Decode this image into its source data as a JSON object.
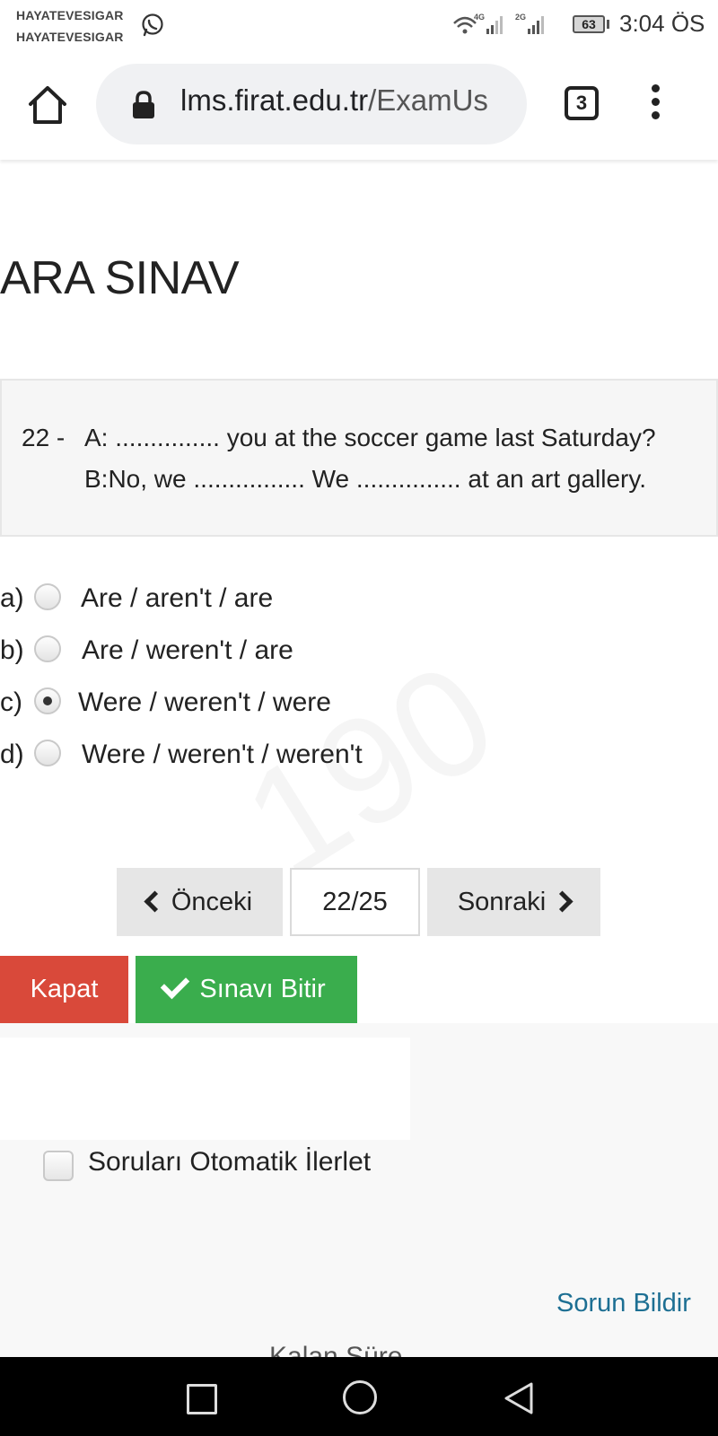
{
  "status_bar": {
    "notification_line1": "HAYATEVESIGAR",
    "notification_line2": "HAYATEVESIGAR",
    "notification_app_icon": "whatsapp-icon",
    "network_label_1": "4G",
    "network_label_2": "2G",
    "battery_level": "63",
    "time": "3:04 ÖS"
  },
  "browser": {
    "url_host": "lms.firat.edu.tr",
    "url_path": "/ExamUs",
    "tab_count": "3",
    "icons": [
      "home-icon",
      "lock-icon",
      "tabs-icon",
      "overflow-menu-icon"
    ]
  },
  "page": {
    "title": "ARA SINAV",
    "question": {
      "number": "22 -",
      "line1": "A: ............... you at the soccer game last Saturday?",
      "line2": "B:No, we ................ We ............... at an art gallery."
    },
    "options": [
      {
        "letter": "a)",
        "text": "Are / aren't / are",
        "selected": false
      },
      {
        "letter": "b)",
        "text": "Are / weren't / are",
        "selected": false
      },
      {
        "letter": "c)",
        "text": "Were / weren't / were",
        "selected": true
      },
      {
        "letter": "d)",
        "text": "Were / weren't / weren't",
        "selected": false
      }
    ],
    "watermark": "190",
    "navigation": {
      "previous_label": "Önceki",
      "counter": "22/25",
      "next_label": "Sonraki"
    },
    "close_label": "Kapat",
    "finish_label": "Sınavı Bitir",
    "auto_advance_label": "Soruları Otomatik İlerlet",
    "auto_advance_checked": false,
    "report_link": "Sorun Bildir",
    "cutoff_text": "Kalan Süre"
  },
  "colors": {
    "close_button": "#d9493a",
    "finish_button": "#3aad4d",
    "link": "#1d6f93",
    "nav_button_bg": "#e6e6e6"
  }
}
